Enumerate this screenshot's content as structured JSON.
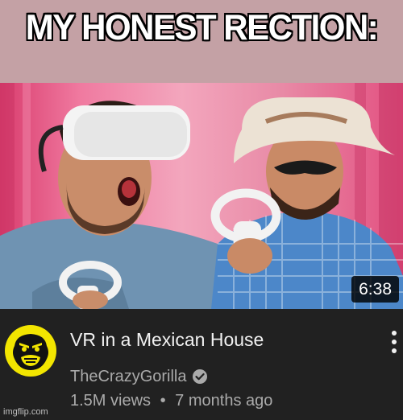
{
  "meme": {
    "caption": "MY HONEST RECTION:",
    "background_color": "#c4a1a5"
  },
  "video": {
    "duration": "6:38",
    "title": "VR in a Mexican House",
    "channel_name": "TheCrazyGorilla",
    "views": "1.5M views",
    "separator": "•",
    "age": "7 months ago",
    "verified_icon": "verified-check-icon",
    "more_icon": "vertical-ellipsis-icon",
    "avatar": "gorilla-logo"
  },
  "watermark": "imgflip.com",
  "colors": {
    "panel_bg": "#212121",
    "title_text": "#f1f1f1",
    "meta_text": "#aaaaaa",
    "avatar_yellow": "#f2e500"
  }
}
